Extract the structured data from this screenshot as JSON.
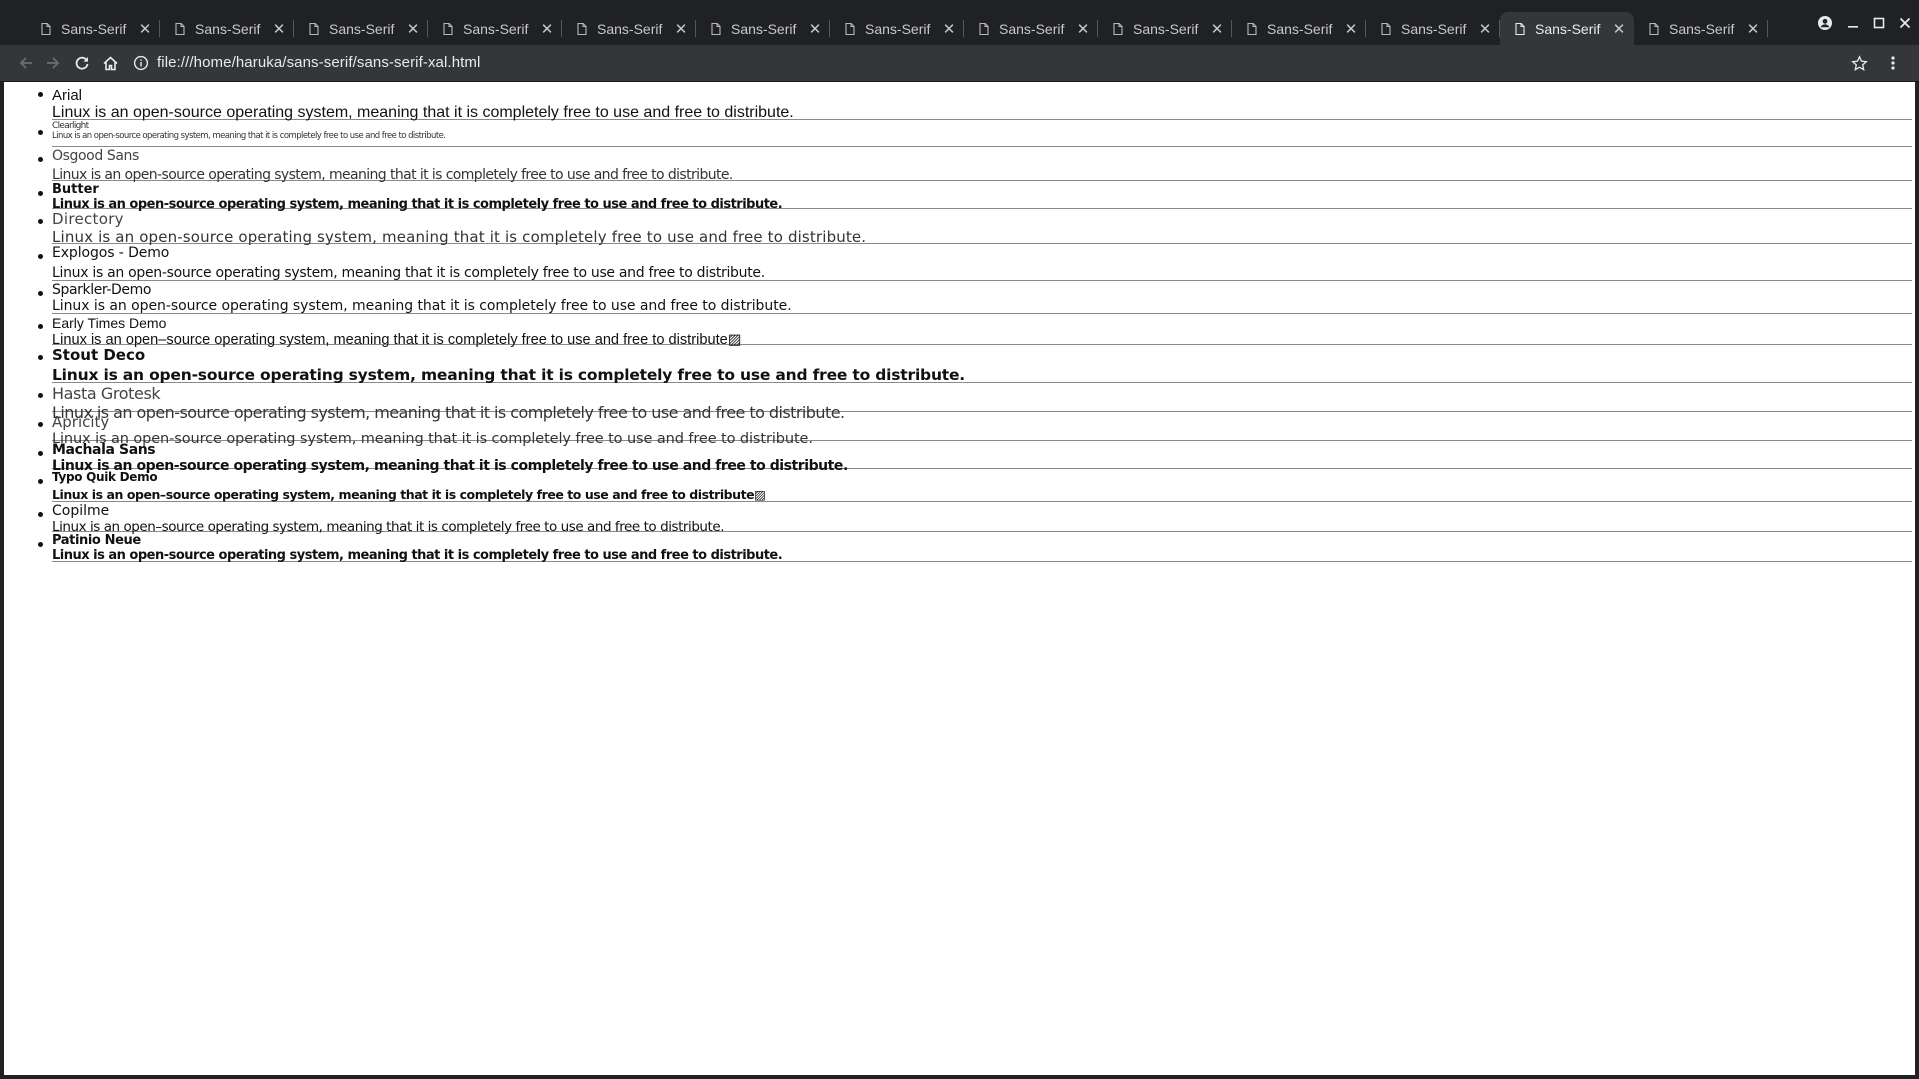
{
  "browser": {
    "tabs": [
      {
        "title": "Sans-Serif",
        "active": false
      },
      {
        "title": "Sans-Serif",
        "active": false
      },
      {
        "title": "Sans-Serif",
        "active": false
      },
      {
        "title": "Sans-Serif",
        "active": false
      },
      {
        "title": "Sans-Serif",
        "active": false
      },
      {
        "title": "Sans-Serif",
        "active": false
      },
      {
        "title": "Sans-Serif",
        "active": false
      },
      {
        "title": "Sans-Serif",
        "active": false
      },
      {
        "title": "Sans-Serif",
        "active": false
      },
      {
        "title": "Sans-Serif",
        "active": false
      },
      {
        "title": "Sans-Serif",
        "active": false
      },
      {
        "title": "Sans-Serif",
        "active": true
      },
      {
        "title": "Sans-Serif",
        "active": false
      }
    ],
    "address": "file:///home/haruka/sans-serif/sans-serif-xal.html",
    "icons": {
      "back": "arrow-left-icon",
      "forward": "arrow-right-icon",
      "reload": "reload-icon",
      "home": "home-icon",
      "info": "info-icon",
      "star": "star-icon",
      "menu": "kebab-menu-icon",
      "profile": "profile-icon",
      "minimize": "minimize-icon",
      "maximize": "maximize-icon",
      "close": "close-icon"
    }
  },
  "fonts": [
    {
      "name": "Arial",
      "sample": "Linux is an open-source operating system, meaning that it is completely free to use and free to distribute."
    },
    {
      "name": "Clearlight",
      "sample": "Linux is an open-source operating system, meaning that it is completely free to use and free to distribute."
    },
    {
      "name": "Osgood Sans",
      "sample": "Linux is an open-source operating system, meaning that it is completely free to use and free to distribute."
    },
    {
      "name": "Butter",
      "sample": "Linux is an open-source operating system, meaning that it is completely free to use and free to distribute."
    },
    {
      "name": "Directory",
      "sample": "Linux is an open-source operating system, meaning that it is completely free to use and free to distribute."
    },
    {
      "name": "Explogos - Demo",
      "sample": "Linux is an open-source operating system, meaning that it is completely free to use and free to distribute."
    },
    {
      "name": "Sparkler-Demo",
      "sample": "Linux is an open-source operating system, meaning that it is completely free to use and free to distribute."
    },
    {
      "name": "Early Times Demo",
      "sample": "Linux is an open–source operating system, meaning that it is completely free to use and free to distribute▨"
    },
    {
      "name": "Stout Deco",
      "sample": "Linux is an open-source operating system, meaning that it is completely free to use and free to distribute."
    },
    {
      "name": "Hasta Grotesk",
      "sample": "Linux is an open-source operating system, meaning that it is completely free to use and free to distribute."
    },
    {
      "name": "Apricity",
      "sample": "Linux is an open-source operating system, meaning that it is completely free to use and free to distribute."
    },
    {
      "name": "Machala Sans",
      "sample": "Linux is an open-source operating system, meaning that it is completely free to use and free to distribute."
    },
    {
      "name": "Typo Quik Demo",
      "sample": "Linux is an open–source operating system, meaning that it is completely free to use and free to distribute▨"
    },
    {
      "name": "Copilme",
      "sample": "Linux is an open–source operating system, meaning that it is completely free to use and free to distribute."
    },
    {
      "name": "Patinio Neue",
      "sample": "Linux is an open-source operating system, meaning that it is completely free to use and free to distribute."
    }
  ]
}
